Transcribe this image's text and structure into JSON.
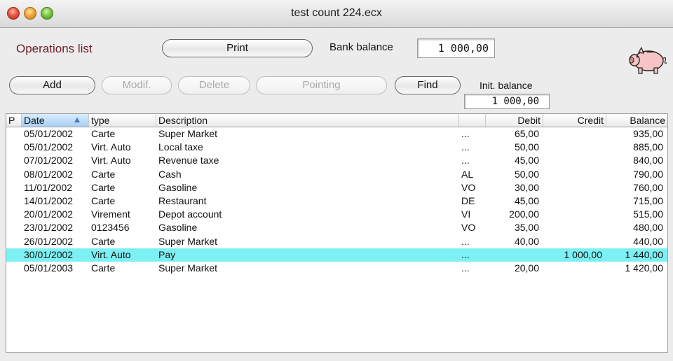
{
  "window": {
    "title": "test count 224.ecx"
  },
  "header": {
    "ops_label": "Operations list",
    "print_label": "Print",
    "bank_balance_label": "Bank balance",
    "bank_balance_value": "1 000,00",
    "init_balance_label": "Init. balance",
    "init_balance_value": "1 000,00"
  },
  "toolbar": {
    "add": "Add",
    "modif": "Modif.",
    "delete": "Delete",
    "pointing": "Pointing",
    "find": "Find"
  },
  "table": {
    "columns": {
      "p": "P",
      "date": "Date",
      "type": "type",
      "description": "Description",
      "pointed": "",
      "debit": "Debit",
      "credit": "Credit",
      "balance": "Balance"
    },
    "selected_row": 9,
    "rows": [
      {
        "date": "05/01/2002",
        "type": "Carte",
        "description": "Super Market",
        "pointed": "...",
        "debit": "65,00",
        "credit": "",
        "balance": "935,00"
      },
      {
        "date": "05/01/2002",
        "type": "Virt. Auto",
        "description": "Local taxe",
        "pointed": "...",
        "debit": "50,00",
        "credit": "",
        "balance": "885,00"
      },
      {
        "date": "07/01/2002",
        "type": "Virt. Auto",
        "description": "Revenue taxe",
        "pointed": "...",
        "debit": "45,00",
        "credit": "",
        "balance": "840,00"
      },
      {
        "date": "08/01/2002",
        "type": "Carte",
        "description": "Cash",
        "pointed": "AL",
        "debit": "50,00",
        "credit": "",
        "balance": "790,00"
      },
      {
        "date": "11/01/2002",
        "type": "Carte",
        "description": "Gasoline",
        "pointed": "VO",
        "debit": "30,00",
        "credit": "",
        "balance": "760,00"
      },
      {
        "date": "14/01/2002",
        "type": "Carte",
        "description": "Restaurant",
        "pointed": "DE",
        "debit": "45,00",
        "credit": "",
        "balance": "715,00"
      },
      {
        "date": "20/01/2002",
        "type": "Virement",
        "description": "Depot account",
        "pointed": "VI",
        "debit": "200,00",
        "credit": "",
        "balance": "515,00"
      },
      {
        "date": "23/01/2002",
        "type": "0123456",
        "description": "Gasoline",
        "pointed": "VO",
        "debit": "35,00",
        "credit": "",
        "balance": "480,00"
      },
      {
        "date": "26/01/2002",
        "type": "Carte",
        "description": "Super Market",
        "pointed": "...",
        "debit": "40,00",
        "credit": "",
        "balance": "440,00"
      },
      {
        "date": "30/01/2002",
        "type": "Virt. Auto",
        "description": "Pay",
        "pointed": "...",
        "debit": "",
        "credit": "1 000,00",
        "balance": "1 440,00"
      },
      {
        "date": "05/01/2003",
        "type": "Carte",
        "description": "Super Market",
        "pointed": "...",
        "debit": "20,00",
        "credit": "",
        "balance": "1 420,00"
      }
    ]
  },
  "icons": {
    "window_close": "close-icon",
    "window_minimize": "minimize-icon",
    "window_zoom": "zoom-icon",
    "app_logo": "piggy-bank-icon",
    "sort": "sort-ascending-icon"
  },
  "colors": {
    "selected_row": "#7df0f4",
    "ops_label": "#6b1f2a",
    "sorted_header": "#a9cff5"
  }
}
